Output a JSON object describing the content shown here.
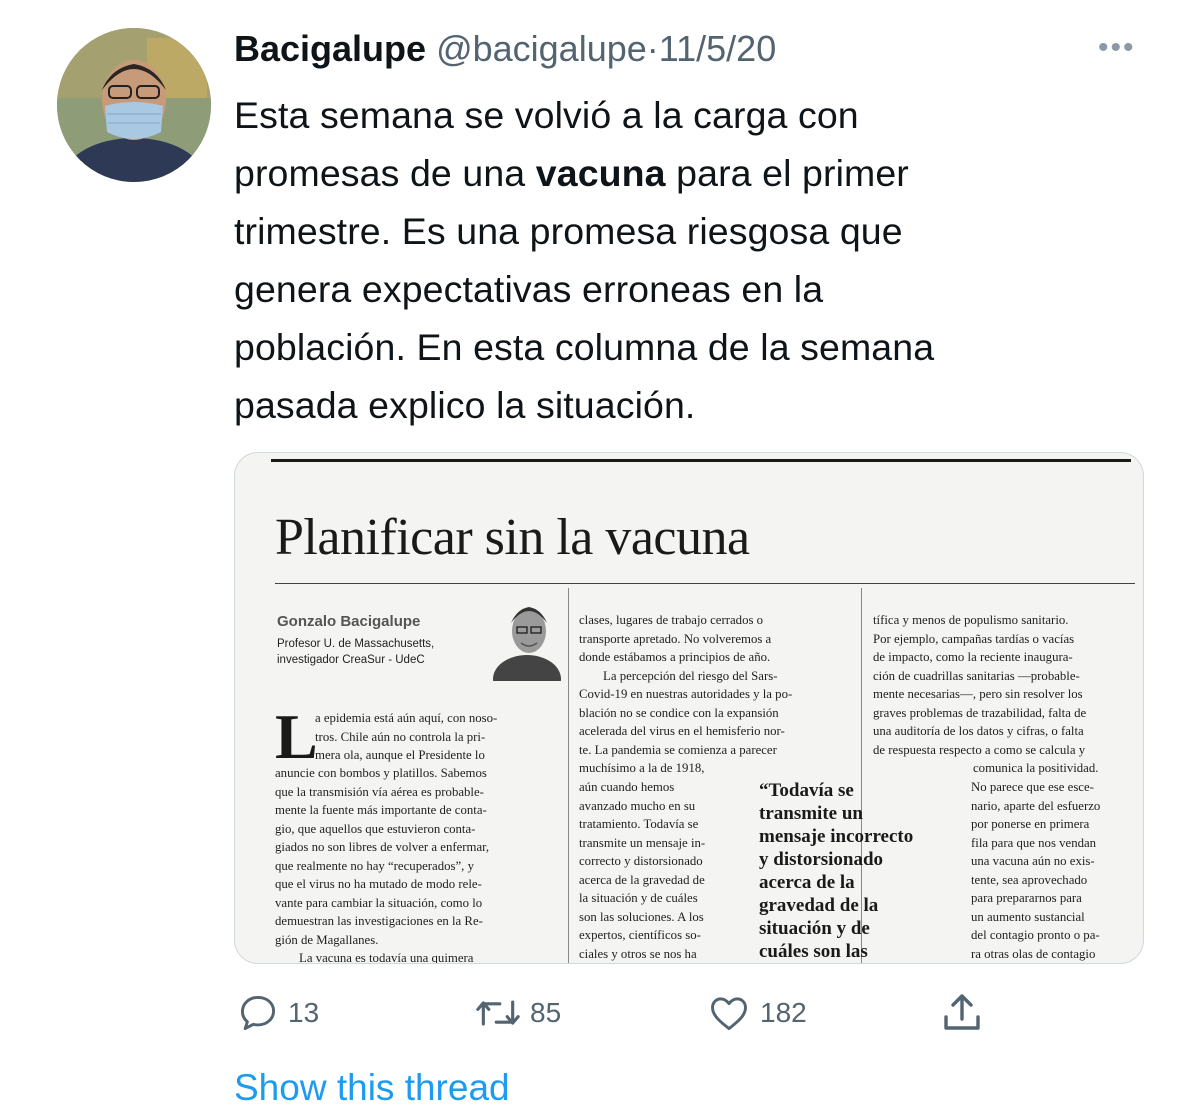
{
  "tweet": {
    "display_name": "Bacigalupe",
    "handle": "@bacigalupe",
    "separator": "·",
    "date": "11/5/20",
    "more": "•••",
    "text_lines": [
      "Esta semana se volvió a la carga con",
      [
        "promesas de una ",
        "vacuna",
        " para el primer"
      ],
      "trimestre. Es una promesa riesgosa que",
      "genera expectativas erroneas en la",
      "población. En esta columna de la semana",
      "pasada explico la situación."
    ]
  },
  "article": {
    "headline": "Planificar sin la vacuna",
    "author": "Gonzalo Bacigalupe",
    "role_line1": "Profesor U. de Massachusetts,",
    "role_line2": "investigador CreaSur - UdeC",
    "dropcap": "L",
    "col1": [
      "a epidemia está aún aquí, con noso-",
      "tros. Chile aún no controla la pri-",
      "mera ola, aunque el Presidente lo",
      "anuncie con bombos y platillos. Sabemos",
      "que la transmisión vía aérea es probable-",
      "mente la fuente más importante de conta-",
      "gio, que aquellos que estuvieron conta-",
      "giados no son libres de volver a enfermar,",
      "que realmente no hay “recuperados”, y",
      "que el virus no ha mutado de modo rele-",
      "vante para cambiar la situación, como lo",
      "demuestran las investigaciones en la Re-",
      "gión de Magallanes.",
      "La vacuna es todavía una quimera"
    ],
    "col2_top": [
      "clases, lugares de trabajo cerrados o",
      "transporte apretado. No volveremos a",
      "donde estábamos a principios de año.",
      "La percepción del riesgo del Sars-",
      "Covid-19 en nuestras autoridades y la po-",
      "blación no se condice con la expansión",
      "acelerada del virus en el hemisferio nor-",
      "te. La pandemia se comienza a parecer",
      "muchísimo a la de 1918,"
    ],
    "col2_narrow": [
      "aún cuando hemos",
      "avanzado mucho en su",
      "tratamiento. Todavía se",
      "transmite un mensaje in-",
      "correcto y distorsionado",
      "acerca de la gravedad de",
      "la situación y de cuáles",
      "son las soluciones. A los",
      "expertos, científicos so-",
      "ciales y otros se nos ha"
    ],
    "quote": [
      "“Todavía se",
      "transmite un",
      "mensaje incorrecto",
      "y distorsionado",
      "acerca de la",
      "gravedad de la",
      "situación y de",
      "cuáles son las"
    ],
    "col3_top": [
      "tífica y menos de populismo sanitario.",
      "Por ejemplo, campañas tardías o vacías",
      "de impacto, como la reciente inaugura-",
      "ción de cuadrillas sanitarias —probable-",
      "mente necesarias—, pero sin resolver los",
      "graves problemas de trazabilidad, falta de",
      "una auditoría de los datos y cifras, o falta",
      "de respuesta respecto a como se calcula y",
      "comunica la positividad."
    ],
    "col3_narrow": [
      "No parece que ese esce-",
      "nario, aparte del esfuerzo",
      "por ponerse en primera",
      "fila para que nos vendan",
      "una vacuna aún no exis-",
      "tente, sea aprovechado",
      "para prepararnos para",
      "un aumento sustancial",
      "del contagio pronto o pa-",
      "ra otras olas de contagio"
    ]
  },
  "actions": {
    "replies": "13",
    "retweets": "85",
    "likes": "182"
  },
  "show_thread": "Show this thread",
  "colors": {
    "link": "#1d9bf0",
    "muted": "#536471"
  }
}
